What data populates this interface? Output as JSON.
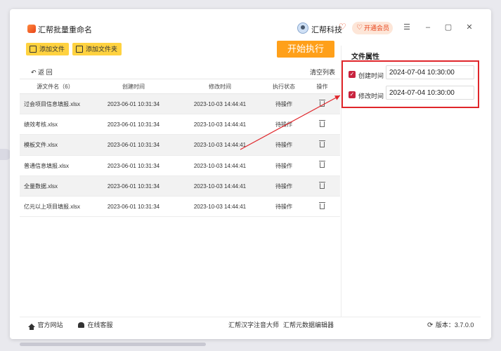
{
  "app": {
    "title": "汇帮批量重命名",
    "user_name": "汇帮科技",
    "vip_label": "开通会员"
  },
  "toolbar": {
    "add_file": "添加文件",
    "add_folder": "添加文件夹",
    "start": "开始执行",
    "back": "返 回",
    "clear": "清空列表"
  },
  "table": {
    "headers": [
      "源文件名（6）",
      "创建时间",
      "修改时间",
      "执行状态",
      "操作"
    ],
    "rows": [
      {
        "name": "过会项目信息填报.xlsx",
        "created": "2023-06-01 10:31:34",
        "modified": "2023-10-03 14:44:41",
        "status": "待操作"
      },
      {
        "name": "绩效考核.xlsx",
        "created": "2023-06-01 10:31:34",
        "modified": "2023-10-03 14:44:41",
        "status": "待操作"
      },
      {
        "name": "模板文件.xlsx",
        "created": "2023-06-01 10:31:34",
        "modified": "2023-10-03 14:44:41",
        "status": "待操作"
      },
      {
        "name": "普通信息填报.xlsx",
        "created": "2023-06-01 10:31:34",
        "modified": "2023-10-03 14:44:41",
        "status": "待操作"
      },
      {
        "name": "全量数据.xlsx",
        "created": "2023-06-01 10:31:34",
        "modified": "2023-10-03 14:44:41",
        "status": "待操作"
      },
      {
        "name": "亿元以上项目填报.xlsx",
        "created": "2023-06-01 10:31:34",
        "modified": "2023-10-03 14:44:41",
        "status": "待操作"
      }
    ]
  },
  "panel": {
    "title": "文件属性",
    "created_label": "创建时间",
    "created_value": "2024-07-04 10:30:00",
    "modified_label": "修改时间",
    "modified_value": "2024-07-04 10:30:00"
  },
  "footer": {
    "website": "官方网站",
    "service": "在线客服",
    "link1": "汇帮汉字注音大师",
    "link2": "汇帮元数据编辑器",
    "version": "版本：3.7.0.0"
  },
  "colors": {
    "accent": "#ffa01a",
    "button_yellow": "#ffd240",
    "highlight_red": "#e0262b",
    "check_red": "#c9243f"
  },
  "icons": [
    "app-logo-icon",
    "avatar-icon",
    "heart-icon",
    "menu-icon",
    "minimize-icon",
    "maximize-icon",
    "close-icon",
    "trash-icon",
    "home-icon",
    "service-icon",
    "refresh-icon"
  ]
}
